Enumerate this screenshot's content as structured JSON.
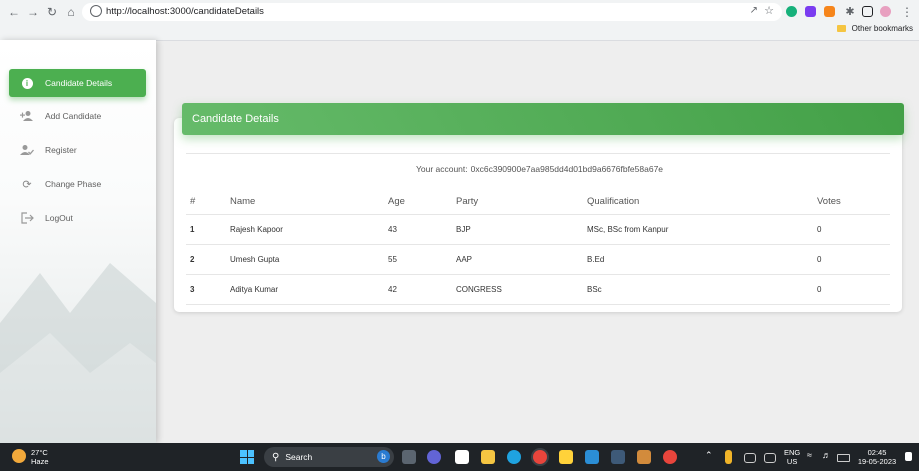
{
  "browser": {
    "url": "http://localhost:3000/candidateDetails",
    "bookmarks": "Other bookmarks"
  },
  "sidebar": {
    "items": [
      {
        "label": "Candidate Details",
        "icon": "info-icon",
        "active": true
      },
      {
        "label": "Add Candidate",
        "icon": "add-person-icon",
        "active": false
      },
      {
        "label": "Register",
        "icon": "person-check-icon",
        "active": false
      },
      {
        "label": "Change Phase",
        "icon": "refresh-icon",
        "active": false
      },
      {
        "label": "LogOut",
        "icon": "logout-icon",
        "active": false
      }
    ]
  },
  "main": {
    "title": "Candidate Details",
    "account_label": "Your account:",
    "account_value": "0xc6c390900e7aa985dd4d01bd9a6676fbfe58a67e",
    "table": {
      "headers": [
        "#",
        "Name",
        "Age",
        "Party",
        "Qualification",
        "Votes"
      ],
      "rows": [
        [
          "1",
          "Rajesh Kapoor",
          "43",
          "BJP",
          "MSc, BSc from Kanpur",
          "0"
        ],
        [
          "2",
          "Umesh Gupta",
          "55",
          "AAP",
          "B.Ed",
          "0"
        ],
        [
          "3",
          "Aditya Kumar",
          "42",
          "CONGRESS",
          "BSc",
          "0"
        ]
      ]
    }
  },
  "taskbar": {
    "temperature": "27°C",
    "weather": "Haze",
    "search": "Search",
    "lang": "ENG",
    "region": "US",
    "time": "02:45",
    "date": "19-05-2023"
  },
  "colors": {
    "accent": "#4caf50",
    "taskbar": "#1f2327"
  }
}
